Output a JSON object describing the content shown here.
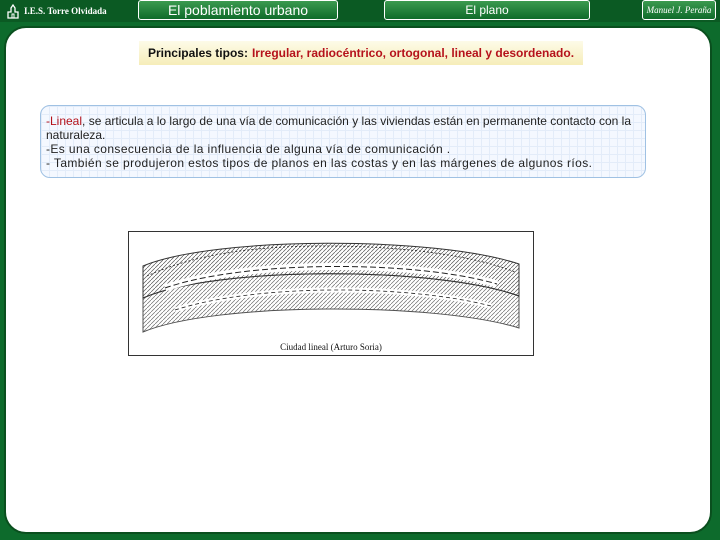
{
  "header": {
    "school": "I.E.S. Torre Olvidada",
    "tab_section": "El poblamiento urbano",
    "tab_topic": "El plano",
    "author": "Manuel J. Peraña"
  },
  "content": {
    "types_label": "Principales tipos:",
    "types_value": "Irregular, radiocéntrico, ortogonal, lineal y desordenado.",
    "lineal_keyword": "-Lineal",
    "lineal_text": ", se articula a lo largo de una vía de comunicación y las viviendas están en permanente contacto con la naturaleza.",
    "point_2": "-Es una consecuencia de la influencia de alguna vía de comunicación .",
    "point_3": "- También se produjeron estos tipos de planos en las costas y en las márgenes de algunos ríos."
  },
  "figure": {
    "caption": "Ciudad lineal (Arturo Soria)"
  },
  "colors": {
    "background": "#0d6b2c",
    "accent_red": "#b5121b",
    "title_band": "#f6edb9"
  }
}
